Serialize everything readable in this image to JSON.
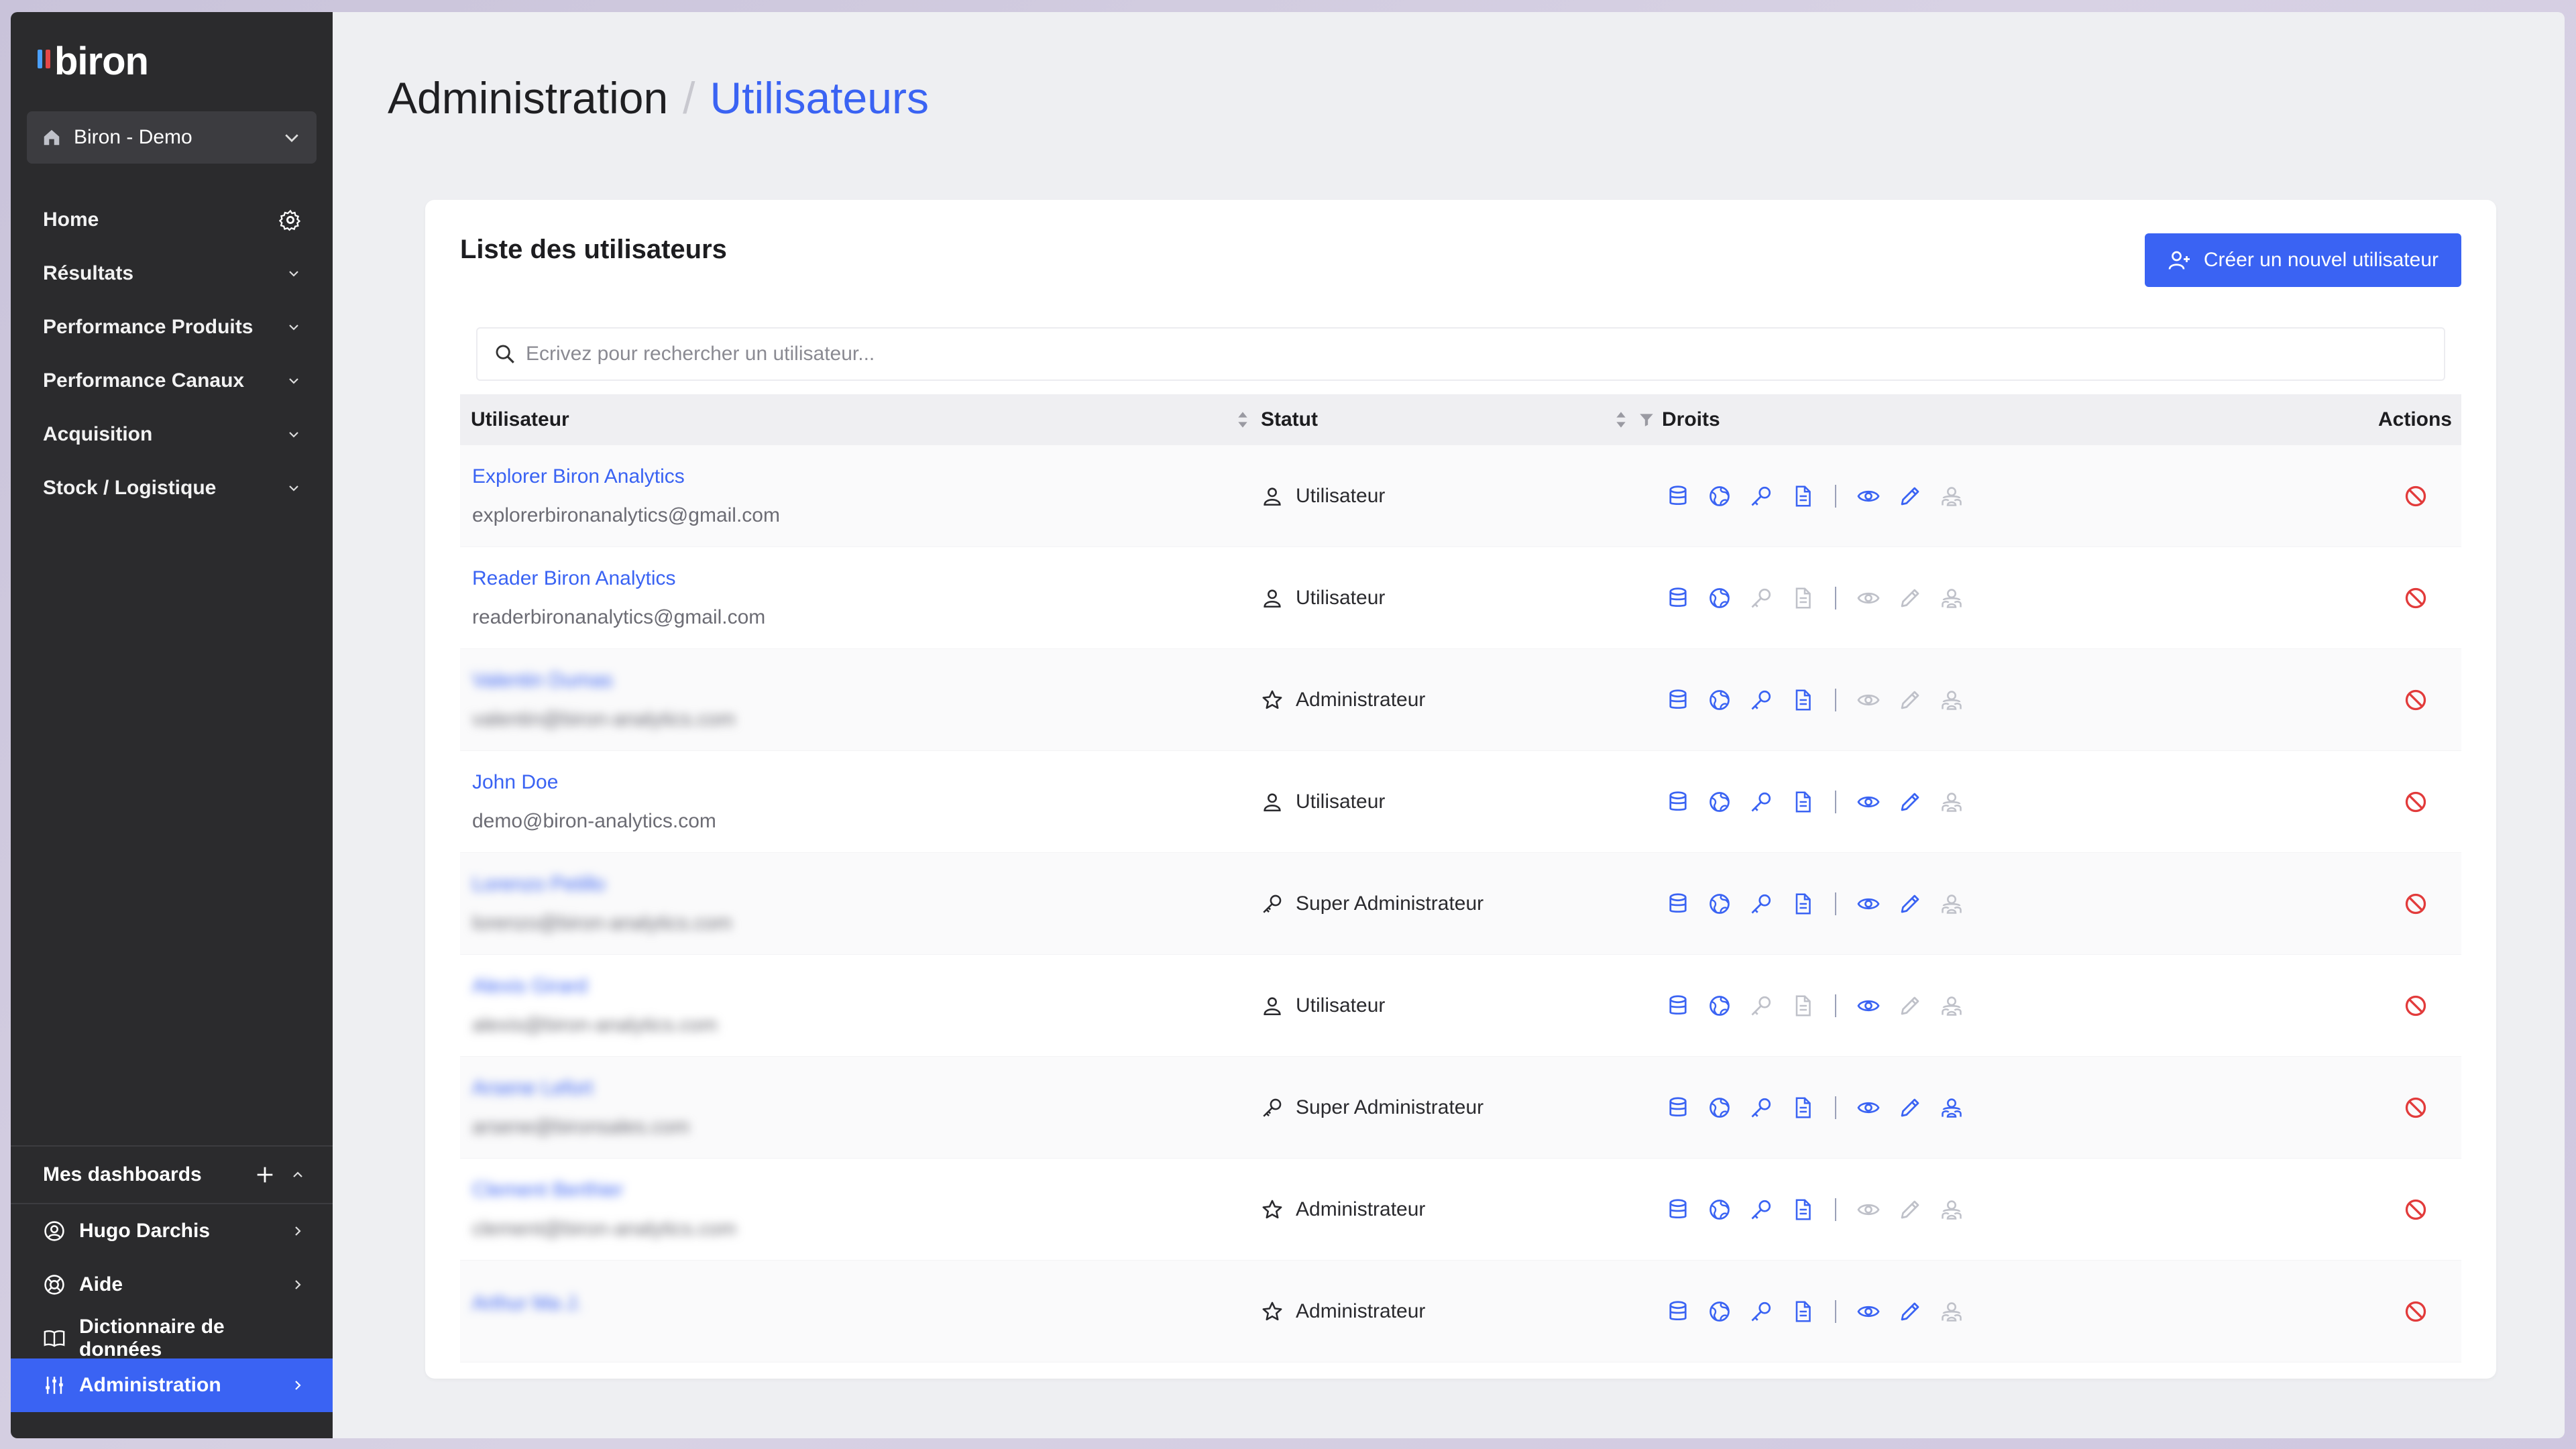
{
  "brand": {
    "name": "biron",
    "mark_colors": [
      "#4aa0ff",
      "#e54848"
    ]
  },
  "colors": {
    "accent": "#3a63f3",
    "danger": "#e23b3b",
    "inactive": "#bfc1c9"
  },
  "workspace": {
    "label": "Biron - Demo"
  },
  "nav": {
    "items": [
      {
        "label": "Home",
        "icon": "gear-icon"
      },
      {
        "label": "Résultats",
        "icon": "chevron-down-icon"
      },
      {
        "label": "Performance Produits",
        "icon": "chevron-down-icon"
      },
      {
        "label": "Performance Canaux",
        "icon": "chevron-down-icon"
      },
      {
        "label": "Acquisition",
        "icon": "chevron-down-icon"
      },
      {
        "label": "Stock / Logistique",
        "icon": "chevron-down-icon"
      }
    ]
  },
  "sidebar_bottom": {
    "dashboards": "Mes dashboards",
    "user": "Hugo Darchis",
    "help": "Aide",
    "dictionary": "Dictionnaire de données",
    "admin": "Administration"
  },
  "header": {
    "section": "Administration",
    "separator": "/",
    "current": "Utilisateurs"
  },
  "card": {
    "title": "Liste des utilisateurs",
    "create_label": "Créer un nouvel utilisateur",
    "search_placeholder": "Ecrivez pour rechercher un utilisateur..."
  },
  "table": {
    "headers": {
      "user": "Utilisateur",
      "status": "Statut",
      "rights": "Droits",
      "actions": "Actions"
    },
    "rows": [
      {
        "name": "Explorer Biron Analytics",
        "email": "explorerbironanalytics@gmail.com",
        "status": "Utilisateur",
        "status_icon": "user-icon",
        "blurred": false,
        "rights": [
          1,
          1,
          1,
          1,
          1,
          1,
          0
        ]
      },
      {
        "name": "Reader Biron Analytics",
        "email": "readerbironanalytics@gmail.com",
        "status": "Utilisateur",
        "status_icon": "user-icon",
        "blurred": false,
        "rights": [
          1,
          1,
          0,
          0,
          0,
          0,
          0
        ]
      },
      {
        "name": "Valentin Dumas",
        "email": "valentin@biron-analytics.com",
        "status": "Administrateur",
        "status_icon": "star-icon",
        "blurred": true,
        "rights": [
          1,
          1,
          1,
          1,
          0,
          0,
          0
        ]
      },
      {
        "name": "John Doe",
        "email": "demo@biron-analytics.com",
        "status": "Utilisateur",
        "status_icon": "user-icon",
        "blurred": false,
        "rights": [
          1,
          1,
          1,
          1,
          1,
          1,
          0
        ]
      },
      {
        "name": "Lorenzo Petillo",
        "email": "lorenzo@biron-analytics.com",
        "status": "Super Administrateur",
        "status_icon": "key-icon",
        "blurred": true,
        "rights": [
          1,
          1,
          1,
          1,
          1,
          1,
          0
        ]
      },
      {
        "name": "Alexis Girard",
        "email": "alexis@biron-analytics.com",
        "status": "Utilisateur",
        "status_icon": "user-icon",
        "blurred": true,
        "rights": [
          1,
          1,
          0,
          0,
          1,
          0,
          0
        ]
      },
      {
        "name": "Arsene Lefort",
        "email": "arsene@bironsales.com",
        "status": "Super Administrateur",
        "status_icon": "key-icon",
        "blurred": true,
        "rights": [
          1,
          1,
          1,
          1,
          1,
          1,
          1
        ]
      },
      {
        "name": "Clement Berthier",
        "email": "clement@biron-analytics.com",
        "status": "Administrateur",
        "status_icon": "star-icon",
        "blurred": true,
        "rights": [
          1,
          1,
          1,
          1,
          0,
          0,
          0
        ]
      },
      {
        "name": "Arthur Ma J.",
        "email": "",
        "status": "Administrateur",
        "status_icon": "star-icon",
        "blurred": true,
        "rights": [
          1,
          1,
          1,
          1,
          1,
          1,
          0
        ]
      }
    ]
  }
}
